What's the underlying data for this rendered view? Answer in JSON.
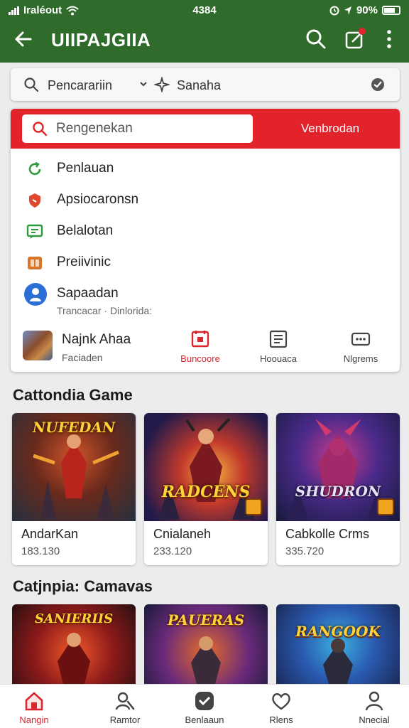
{
  "status_bar": {
    "carrier": "Iraléout",
    "time": "4384",
    "battery": "90%"
  },
  "header": {
    "title": "UIIPAJGIIA"
  },
  "search_row": {
    "label_left": "Pencarariin",
    "label_right": "Sanaha"
  },
  "dropdown": {
    "search_placeholder": "Rengenekan",
    "search_button": "Venbrodan",
    "options": [
      {
        "label": "Penlauan",
        "icon": "refresh-icon",
        "color": "#2e9a3d"
      },
      {
        "label": "Apsiocaronsn",
        "icon": "shield-icon",
        "color": "#e0472f"
      },
      {
        "label": "Belalotan",
        "icon": "message-icon",
        "color": "#2e9a3d"
      },
      {
        "label": "Preiivinic",
        "icon": "tag-icon",
        "color": "#d9752b"
      },
      {
        "label": "Sapaadan",
        "sublabel": "Trancacar · Dinlorida:",
        "icon": "profile-icon",
        "color": "#2b6fd6"
      }
    ],
    "app": {
      "name": "Najnk Ahaa",
      "sub": "Faciaden"
    },
    "quick_actions": [
      {
        "label": "Buncoore",
        "icon": "calendar-icon",
        "active": true
      },
      {
        "label": "Hoouaca",
        "icon": "list-icon",
        "active": false
      },
      {
        "label": "Nlgrems",
        "icon": "grid-icon",
        "active": false
      }
    ]
  },
  "sections": [
    {
      "title": "Cattondia Game",
      "games": [
        {
          "name": "AndarKan",
          "count": "183.130",
          "art_title": "NUFEDAN"
        },
        {
          "name": "Cnialaneh",
          "count": "233.120",
          "art_title": "RADCENS"
        },
        {
          "name": "Cabkolle Crms",
          "count": "335.720",
          "art_title": "SHUDRON"
        }
      ]
    },
    {
      "title": "Catjnpia: Camavas",
      "games": [
        {
          "art_title": "SANIERIIS"
        },
        {
          "art_title": "PAUERAS"
        },
        {
          "art_title": "RANGOOK"
        }
      ]
    }
  ],
  "bottom_nav": [
    {
      "label": "Nangin",
      "icon": "home-icon",
      "active": true
    },
    {
      "label": "Ramtor",
      "icon": "search-people-icon",
      "active": false
    },
    {
      "label": "Benlaaun",
      "icon": "check-badge-icon",
      "active": false
    },
    {
      "label": "Rlens",
      "icon": "heart-icon",
      "active": false
    },
    {
      "label": "Nnecial",
      "icon": "person-icon",
      "active": false
    }
  ],
  "colors": {
    "header": "#2f6b2a",
    "accent_red": "#e2232b",
    "background": "#ececec"
  }
}
